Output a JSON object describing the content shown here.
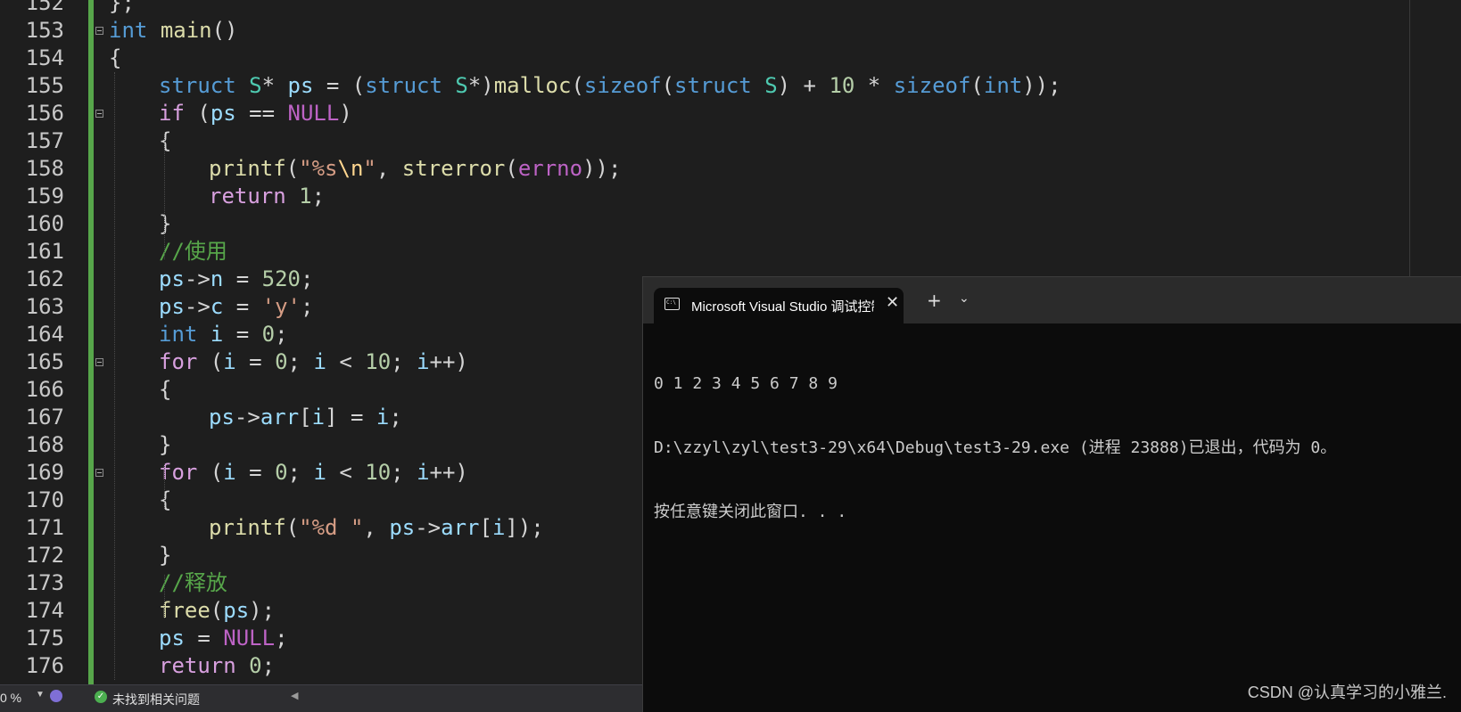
{
  "editor": {
    "lines": [
      {
        "n": "152",
        "indent": 0,
        "tokens": [
          [
            "pn",
            "};"
          ]
        ]
      },
      {
        "n": "153",
        "indent": 0,
        "tokens": [
          [
            "kw",
            "int"
          ],
          [
            "pn",
            " "
          ],
          [
            "fn",
            "main"
          ],
          [
            "pn",
            "()"
          ]
        ]
      },
      {
        "n": "154",
        "indent": 0,
        "tokens": [
          [
            "pn",
            "{"
          ]
        ]
      },
      {
        "n": "155",
        "indent": 1,
        "tokens": [
          [
            "kw",
            "struct"
          ],
          [
            "pn",
            " "
          ],
          [
            "ty",
            "S"
          ],
          [
            "pn",
            "* "
          ],
          [
            "var",
            "ps"
          ],
          [
            "pn",
            " = ("
          ],
          [
            "kw",
            "struct"
          ],
          [
            "pn",
            " "
          ],
          [
            "ty",
            "S"
          ],
          [
            "pn",
            "*)"
          ],
          [
            "fn",
            "malloc"
          ],
          [
            "pn",
            "("
          ],
          [
            "kw",
            "sizeof"
          ],
          [
            "pn",
            "("
          ],
          [
            "kw",
            "struct"
          ],
          [
            "pn",
            " "
          ],
          [
            "ty",
            "S"
          ],
          [
            "pn",
            ") + "
          ],
          [
            "num",
            "10"
          ],
          [
            "pn",
            " * "
          ],
          [
            "kw",
            "sizeof"
          ],
          [
            "pn",
            "("
          ],
          [
            "kw",
            "int"
          ],
          [
            "pn",
            "));"
          ]
        ]
      },
      {
        "n": "156",
        "indent": 1,
        "tokens": [
          [
            "ctl",
            "if"
          ],
          [
            "pn",
            " ("
          ],
          [
            "var",
            "ps"
          ],
          [
            "pn",
            " == "
          ],
          [
            "mac",
            "NULL"
          ],
          [
            "pn",
            ")"
          ]
        ]
      },
      {
        "n": "157",
        "indent": 1,
        "tokens": [
          [
            "pn",
            "{"
          ]
        ]
      },
      {
        "n": "158",
        "indent": 2,
        "tokens": [
          [
            "fn",
            "printf"
          ],
          [
            "pn",
            "("
          ],
          [
            "str",
            "\"%s"
          ],
          [
            "esc",
            "\\n"
          ],
          [
            "str",
            "\""
          ],
          [
            "pn",
            ", "
          ],
          [
            "fn",
            "strerror"
          ],
          [
            "pn",
            "("
          ],
          [
            "mac",
            "errno"
          ],
          [
            "pn",
            "));"
          ]
        ]
      },
      {
        "n": "159",
        "indent": 2,
        "tokens": [
          [
            "ctl",
            "return"
          ],
          [
            "pn",
            " "
          ],
          [
            "num",
            "1"
          ],
          [
            "pn",
            ";"
          ]
        ]
      },
      {
        "n": "160",
        "indent": 1,
        "tokens": [
          [
            "pn",
            "}"
          ]
        ]
      },
      {
        "n": "161",
        "indent": 1,
        "tokens": [
          [
            "cm",
            "//使用"
          ]
        ]
      },
      {
        "n": "162",
        "indent": 1,
        "tokens": [
          [
            "var",
            "ps"
          ],
          [
            "pn",
            "->"
          ],
          [
            "var",
            "n"
          ],
          [
            "pn",
            " = "
          ],
          [
            "num",
            "520"
          ],
          [
            "pn",
            ";"
          ]
        ]
      },
      {
        "n": "163",
        "indent": 1,
        "tokens": [
          [
            "var",
            "ps"
          ],
          [
            "pn",
            "->"
          ],
          [
            "var",
            "c"
          ],
          [
            "pn",
            " = "
          ],
          [
            "str",
            "'y'"
          ],
          [
            "pn",
            ";"
          ]
        ]
      },
      {
        "n": "164",
        "indent": 1,
        "tokens": [
          [
            "kw",
            "int"
          ],
          [
            "pn",
            " "
          ],
          [
            "var",
            "i"
          ],
          [
            "pn",
            " = "
          ],
          [
            "num",
            "0"
          ],
          [
            "pn",
            ";"
          ]
        ]
      },
      {
        "n": "165",
        "indent": 1,
        "tokens": [
          [
            "ctl",
            "for"
          ],
          [
            "pn",
            " ("
          ],
          [
            "var",
            "i"
          ],
          [
            "pn",
            " = "
          ],
          [
            "num",
            "0"
          ],
          [
            "pn",
            "; "
          ],
          [
            "var",
            "i"
          ],
          [
            "pn",
            " < "
          ],
          [
            "num",
            "10"
          ],
          [
            "pn",
            "; "
          ],
          [
            "var",
            "i"
          ],
          [
            "pn",
            "++)"
          ]
        ]
      },
      {
        "n": "166",
        "indent": 1,
        "tokens": [
          [
            "pn",
            "{"
          ]
        ]
      },
      {
        "n": "167",
        "indent": 2,
        "tokens": [
          [
            "var",
            "ps"
          ],
          [
            "pn",
            "->"
          ],
          [
            "var",
            "arr"
          ],
          [
            "pn",
            "["
          ],
          [
            "var",
            "i"
          ],
          [
            "pn",
            "] = "
          ],
          [
            "var",
            "i"
          ],
          [
            "pn",
            ";"
          ]
        ]
      },
      {
        "n": "168",
        "indent": 1,
        "tokens": [
          [
            "pn",
            "}"
          ]
        ]
      },
      {
        "n": "169",
        "indent": 1,
        "tokens": [
          [
            "ctl",
            "for"
          ],
          [
            "pn",
            " ("
          ],
          [
            "var",
            "i"
          ],
          [
            "pn",
            " = "
          ],
          [
            "num",
            "0"
          ],
          [
            "pn",
            "; "
          ],
          [
            "var",
            "i"
          ],
          [
            "pn",
            " < "
          ],
          [
            "num",
            "10"
          ],
          [
            "pn",
            "; "
          ],
          [
            "var",
            "i"
          ],
          [
            "pn",
            "++)"
          ]
        ]
      },
      {
        "n": "170",
        "indent": 1,
        "tokens": [
          [
            "pn",
            "{"
          ]
        ]
      },
      {
        "n": "171",
        "indent": 2,
        "tokens": [
          [
            "fn",
            "printf"
          ],
          [
            "pn",
            "("
          ],
          [
            "str",
            "\"%d \""
          ],
          [
            "pn",
            ", "
          ],
          [
            "var",
            "ps"
          ],
          [
            "pn",
            "->"
          ],
          [
            "var",
            "arr"
          ],
          [
            "pn",
            "["
          ],
          [
            "var",
            "i"
          ],
          [
            "pn",
            "]);"
          ]
        ]
      },
      {
        "n": "172",
        "indent": 1,
        "tokens": [
          [
            "pn",
            "}"
          ]
        ]
      },
      {
        "n": "173",
        "indent": 1,
        "tokens": [
          [
            "cm",
            "//释放"
          ]
        ]
      },
      {
        "n": "174",
        "indent": 1,
        "tokens": [
          [
            "fn",
            "free"
          ],
          [
            "pn",
            "("
          ],
          [
            "var",
            "ps"
          ],
          [
            "pn",
            ");"
          ]
        ]
      },
      {
        "n": "175",
        "indent": 1,
        "tokens": [
          [
            "var",
            "ps"
          ],
          [
            "pn",
            " = "
          ],
          [
            "mac",
            "NULL"
          ],
          [
            "pn",
            ";"
          ]
        ]
      },
      {
        "n": "176",
        "indent": 1,
        "tokens": [
          [
            "ctl",
            "return"
          ],
          [
            "pn",
            " "
          ],
          [
            "num",
            "0"
          ],
          [
            "pn",
            ";"
          ]
        ]
      }
    ],
    "fold_lines": [
      "153",
      "156",
      "165",
      "169"
    ]
  },
  "terminal": {
    "tab_title": "Microsoft Visual Studio 调试控制台",
    "tab_icon": "console-icon",
    "close_glyph": "✕",
    "new_tab_glyph": "+",
    "dropdown_glyph": "⌄",
    "output": [
      "0 1 2 3 4 5 6 7 8 9",
      "D:\\zzyl\\zyl\\test3-29\\x64\\Debug\\test3-29.exe (进程 23888)已退出，代码为 0。",
      "按任意键关闭此窗口. . ."
    ],
    "watermark": "CSDN @认真学习的小雅兰."
  },
  "statusbar": {
    "zoom": "0 %",
    "issues_text": "未找到相关问题",
    "issues_icon": "check-circle-icon",
    "colors": {
      "ok": "#4caf50",
      "brush": "#7f6fd6"
    }
  },
  "colors": {
    "background": "#1e1e1e",
    "terminal_bg": "#0c0c0c",
    "change_bar": "#57a64a",
    "keyword": "#569cd6",
    "control": "#d8a0df",
    "type": "#4ec9b0",
    "function": "#dcdcaa",
    "variable": "#9cdcfe",
    "number": "#b5cea8",
    "string": "#d69d85",
    "comment": "#57a64a"
  }
}
